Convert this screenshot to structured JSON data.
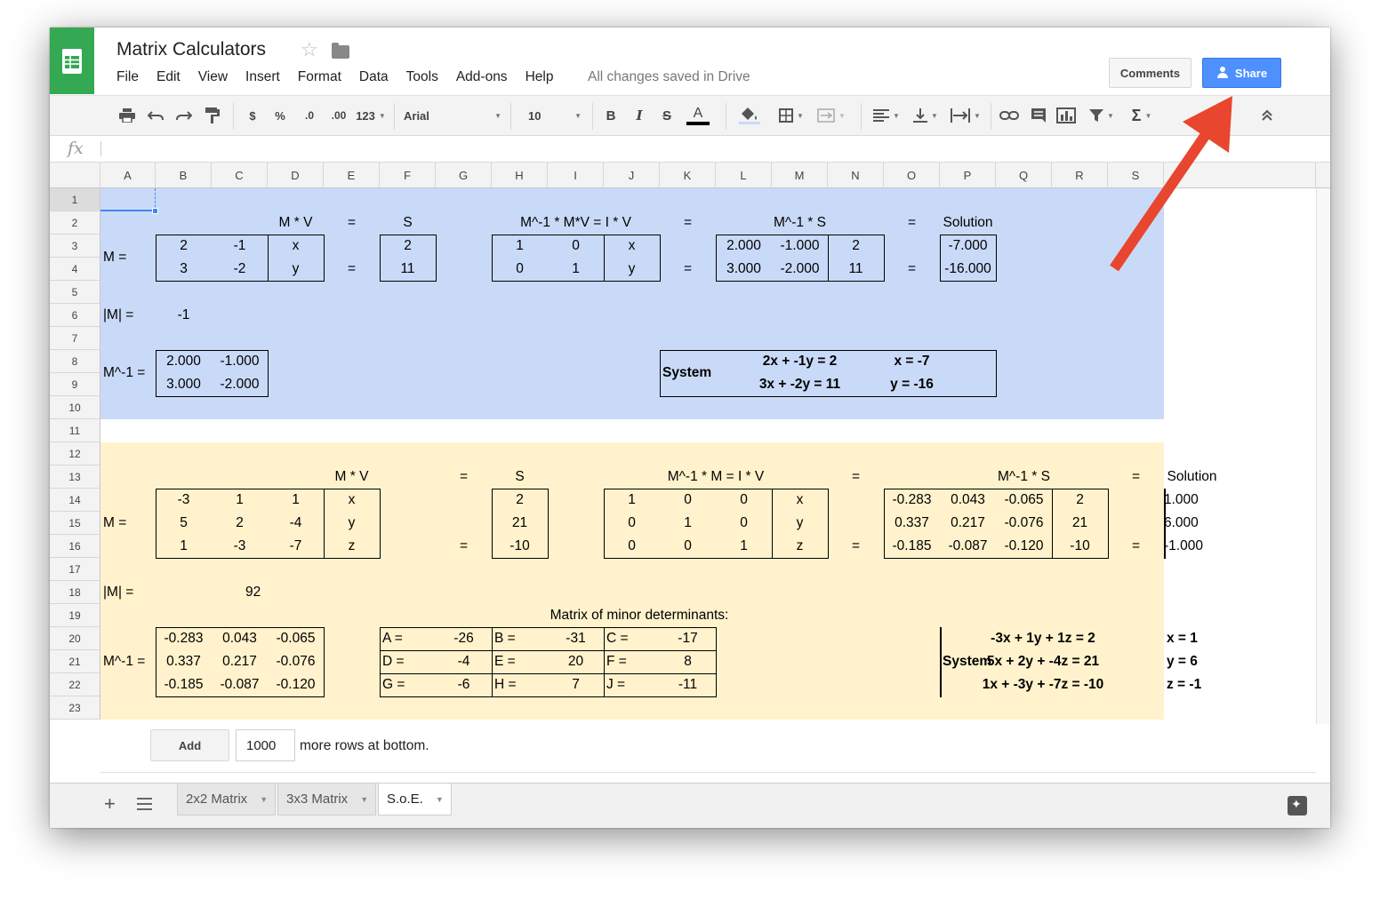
{
  "window": {
    "doc_title": "Matrix Calculators",
    "menus": [
      "File",
      "Edit",
      "View",
      "Insert",
      "Format",
      "Data",
      "Tools",
      "Add-ons",
      "Help"
    ],
    "save_status": "All changes saved in Drive",
    "comments_label": "Comments",
    "share_label": "Share"
  },
  "toolbar": {
    "currency": "$",
    "percent": "%",
    "dec_decrease": ".0",
    "dec_increase": ".00",
    "more_formats": "123",
    "font": "Arial",
    "font_size": "10",
    "bold": "B",
    "italic": "I",
    "strike": "S",
    "text_color": "A",
    "sum": "Σ"
  },
  "formula_bar": {
    "fx": "fx",
    "value": ""
  },
  "columns": [
    "A",
    "B",
    "C",
    "D",
    "E",
    "F",
    "G",
    "H",
    "I",
    "J",
    "K",
    "L",
    "M",
    "N",
    "O",
    "P",
    "Q",
    "R",
    "S"
  ],
  "rows": [
    "1",
    "2",
    "3",
    "4",
    "5",
    "6",
    "7",
    "8",
    "9",
    "10",
    "11",
    "12",
    "13",
    "14",
    "15",
    "16",
    "17",
    "18",
    "19",
    "20",
    "21",
    "22",
    "23"
  ],
  "colors": {
    "blue_block": "#c9daf8",
    "yellow_block": "#fff2cc",
    "share": "#4d90fe",
    "logo": "#34a853",
    "arrow": "#e8462f"
  },
  "block2x2": {
    "h_mv": "M *  V",
    "h_eq1": "=",
    "h_s": "S",
    "h_inv": "M^-1 * M*V = I * V",
    "h_eq2": "=",
    "h_invs": "M^-1 * S",
    "h_eq3": "=",
    "h_sol": "Solution",
    "m_label": "M =",
    "m": [
      [
        "2",
        "-1",
        "x"
      ],
      [
        "3",
        "-2",
        "y"
      ]
    ],
    "eq_row4a": "=",
    "eq_row4b": "=",
    "eq_row4c": "=",
    "s": [
      "2",
      "11"
    ],
    "iv": [
      [
        "1",
        "0",
        "x"
      ],
      [
        "0",
        "1",
        "y"
      ]
    ],
    "invs": [
      [
        "2.000",
        "-1.000",
        "2"
      ],
      [
        "3.000",
        "-2.000",
        "11"
      ]
    ],
    "sol": [
      "-7.000",
      "-16.000"
    ],
    "det_label": "|M| =",
    "det": "-1",
    "inv_label": "M^-1 =",
    "inv": [
      [
        "2.000",
        "-1.000"
      ],
      [
        "3.000",
        "-2.000"
      ]
    ],
    "sys_label": "System",
    "sys_eq": [
      "2x + -1y = 2",
      "3x + -2y = 11"
    ],
    "sys_ans": [
      "x = -7",
      "y = -16"
    ]
  },
  "block3x3": {
    "h_mv": "M *  V",
    "h_eq1": "=",
    "h_s": "S",
    "h_inv": "M^-1 * M = I * V",
    "h_eq2": "=",
    "h_invs": "M^-1 * S",
    "h_eq3": "=",
    "h_sol": "Solution",
    "m_label": "M =",
    "m": [
      [
        "-3",
        "1",
        "1",
        "x"
      ],
      [
        "5",
        "2",
        "-4",
        "y"
      ],
      [
        "1",
        "-3",
        "-7",
        "z"
      ]
    ],
    "eq_row16a": "=",
    "eq_row16b": "=",
    "eq_row16c": "=",
    "s": [
      "2",
      "21",
      "-10"
    ],
    "iv": [
      [
        "1",
        "0",
        "0",
        "x"
      ],
      [
        "0",
        "1",
        "0",
        "y"
      ],
      [
        "0",
        "0",
        "1",
        "z"
      ]
    ],
    "invs": [
      [
        "-0.283",
        "0.043",
        "-0.065",
        "2"
      ],
      [
        "0.337",
        "0.217",
        "-0.076",
        "21"
      ],
      [
        "-0.185",
        "-0.087",
        "-0.120",
        "-10"
      ]
    ],
    "sol": [
      "1.000",
      "6.000",
      "-1.000"
    ],
    "det_label": "|M| =",
    "det": "92",
    "minor_title": "Matrix of minor determinants:",
    "inv_label": "M^-1 =",
    "inv": [
      [
        "-0.283",
        "0.043",
        "-0.065"
      ],
      [
        "0.337",
        "0.217",
        "-0.076"
      ],
      [
        "-0.185",
        "-0.087",
        "-0.120"
      ]
    ],
    "minors": [
      [
        "A =",
        "-26",
        "B =",
        "-31",
        "C =",
        "-17"
      ],
      [
        "D =",
        "-4",
        "E =",
        "20",
        "F =",
        "8"
      ],
      [
        "G =",
        "-6",
        "H =",
        "7",
        "J =",
        "-11"
      ]
    ],
    "sys_label": "System",
    "sys_eq": [
      "-3x + 1y + 1z = 2",
      "5x + 2y + -4z = 21",
      "1x + -3y + -7z = -10"
    ],
    "sys_ans": [
      "x = 1",
      "y = 6",
      "z = -1"
    ]
  },
  "add_rows": {
    "button": "Add",
    "count": "1000",
    "suffix": "more rows at bottom."
  },
  "tabs": [
    {
      "label": "2x2 Matrix",
      "active": false
    },
    {
      "label": "3x3 Matrix",
      "active": false
    },
    {
      "label": "S.o.E.",
      "active": true
    }
  ],
  "icons": [
    "sheets-logo-icon",
    "star-icon",
    "folder-icon",
    "print-icon",
    "undo-icon",
    "redo-icon",
    "paint-format-icon",
    "fill-color-icon",
    "borders-icon",
    "merge-icon",
    "align-icon",
    "valign-icon",
    "wrap-icon",
    "link-icon",
    "comment-icon",
    "chart-icon",
    "filter-icon",
    "collapse-icon",
    "add-sheet-icon",
    "sheet-list-icon",
    "explore-icon",
    "share-person-icon"
  ]
}
